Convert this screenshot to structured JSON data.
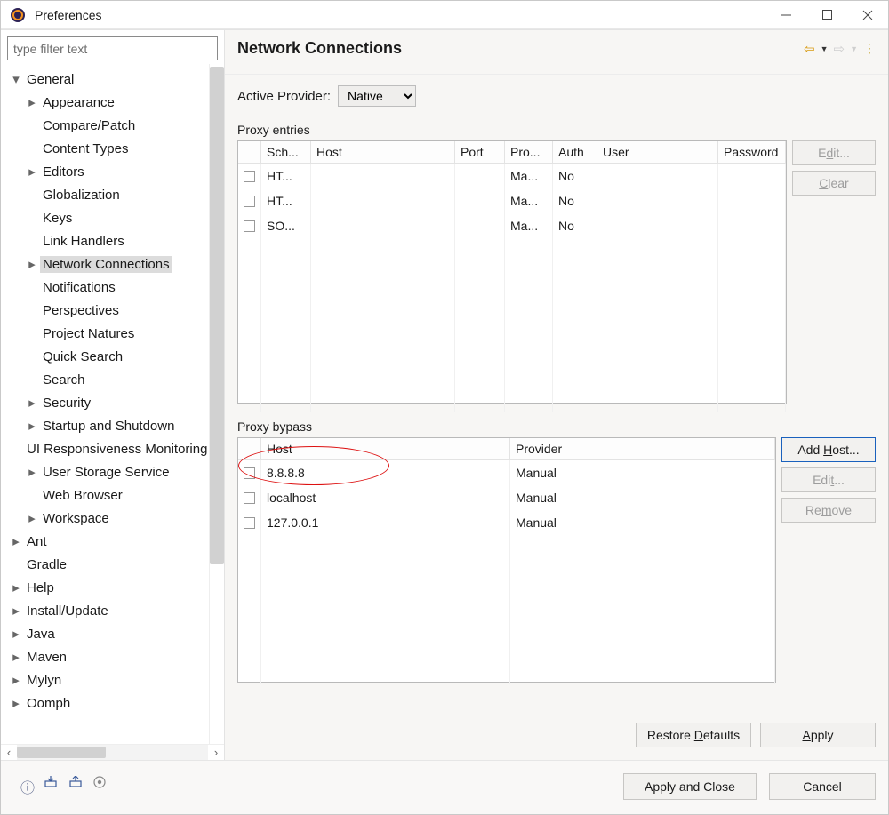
{
  "window": {
    "title": "Preferences"
  },
  "filter_placeholder": "type filter text",
  "tree": [
    {
      "label": "General",
      "level": 0,
      "twisty": "▾"
    },
    {
      "label": "Appearance",
      "level": 1,
      "twisty": "▸"
    },
    {
      "label": "Compare/Patch",
      "level": 1,
      "twisty": ""
    },
    {
      "label": "Content Types",
      "level": 1,
      "twisty": ""
    },
    {
      "label": "Editors",
      "level": 1,
      "twisty": "▸"
    },
    {
      "label": "Globalization",
      "level": 1,
      "twisty": ""
    },
    {
      "label": "Keys",
      "level": 1,
      "twisty": ""
    },
    {
      "label": "Link Handlers",
      "level": 1,
      "twisty": ""
    },
    {
      "label": "Network Connections",
      "level": 1,
      "twisty": "▸",
      "selected": true
    },
    {
      "label": "Notifications",
      "level": 1,
      "twisty": ""
    },
    {
      "label": "Perspectives",
      "level": 1,
      "twisty": ""
    },
    {
      "label": "Project Natures",
      "level": 1,
      "twisty": ""
    },
    {
      "label": "Quick Search",
      "level": 1,
      "twisty": ""
    },
    {
      "label": "Search",
      "level": 1,
      "twisty": ""
    },
    {
      "label": "Security",
      "level": 1,
      "twisty": "▸"
    },
    {
      "label": "Startup and Shutdown",
      "level": 1,
      "twisty": "▸"
    },
    {
      "label": "UI Responsiveness Monitoring",
      "level": 1,
      "twisty": ""
    },
    {
      "label": "User Storage Service",
      "level": 1,
      "twisty": "▸"
    },
    {
      "label": "Web Browser",
      "level": 1,
      "twisty": ""
    },
    {
      "label": "Workspace",
      "level": 1,
      "twisty": "▸"
    },
    {
      "label": "Ant",
      "level": 0,
      "twisty": "▸"
    },
    {
      "label": "Gradle",
      "level": 0,
      "twisty": ""
    },
    {
      "label": "Help",
      "level": 0,
      "twisty": "▸"
    },
    {
      "label": "Install/Update",
      "level": 0,
      "twisty": "▸"
    },
    {
      "label": "Java",
      "level": 0,
      "twisty": "▸"
    },
    {
      "label": "Maven",
      "level": 0,
      "twisty": "▸"
    },
    {
      "label": "Mylyn",
      "level": 0,
      "twisty": "▸"
    },
    {
      "label": "Oomph",
      "level": 0,
      "twisty": "▸"
    }
  ],
  "page": {
    "title": "Network Connections",
    "provider_label": "Active Provider:",
    "provider_value": "Native"
  },
  "entries": {
    "label": "Proxy entries",
    "headers": [
      "",
      "Sch...",
      "Host",
      "Port",
      "Pro...",
      "Auth",
      "User",
      "Password"
    ],
    "rows": [
      {
        "schema": "HT...",
        "host": "",
        "port": "",
        "provider": "Ma...",
        "auth": "No",
        "user": "",
        "password": ""
      },
      {
        "schema": "HT...",
        "host": "",
        "port": "",
        "provider": "Ma...",
        "auth": "No",
        "user": "",
        "password": ""
      },
      {
        "schema": "SO...",
        "host": "",
        "port": "",
        "provider": "Ma...",
        "auth": "No",
        "user": "",
        "password": ""
      }
    ],
    "buttons": {
      "edit": "Edit...",
      "clear": "Clear"
    }
  },
  "bypass": {
    "label": "Proxy bypass",
    "headers": [
      "",
      "Host",
      "Provider"
    ],
    "rows": [
      {
        "host": "8.8.8.8",
        "provider": "Manual",
        "annot": true
      },
      {
        "host": "localhost",
        "provider": "Manual"
      },
      {
        "host": "127.0.0.1",
        "provider": "Manual"
      }
    ],
    "buttons": {
      "add": "Add Host...",
      "edit": "Edit...",
      "remove": "Remove"
    }
  },
  "footerPage": {
    "restore": "Restore Defaults",
    "apply": "Apply"
  },
  "dialog": {
    "applyClose": "Apply and Close",
    "cancel": "Cancel"
  }
}
